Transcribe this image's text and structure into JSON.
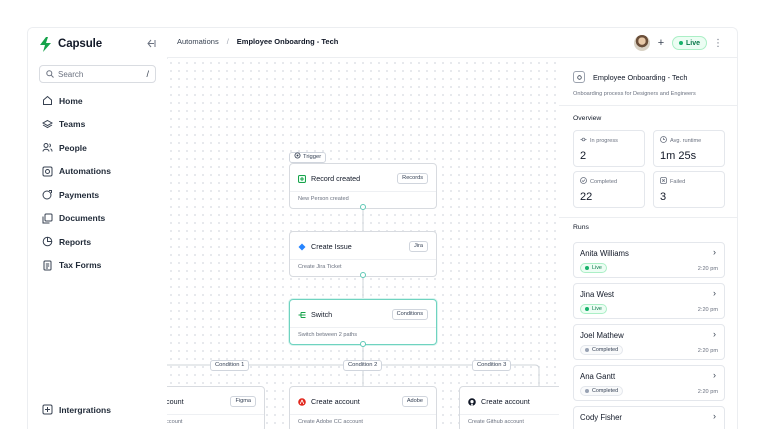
{
  "app": {
    "name": "Capsule"
  },
  "sidebar": {
    "search_placeholder": "Search",
    "search_shortcut": "/",
    "items": [
      {
        "label": "Home",
        "icon": "home-icon"
      },
      {
        "label": "Teams",
        "icon": "layers-icon"
      },
      {
        "label": "People",
        "icon": "users-icon"
      },
      {
        "label": "Automations",
        "icon": "automation-icon"
      },
      {
        "label": "Payments",
        "icon": "payments-icon"
      },
      {
        "label": "Documents",
        "icon": "documents-icon"
      },
      {
        "label": "Reports",
        "icon": "pie-chart-icon"
      },
      {
        "label": "Tax Forms",
        "icon": "file-text-icon"
      }
    ],
    "bottom_items": [
      {
        "label": "Intergrations",
        "icon": "integrations-icon"
      }
    ]
  },
  "header": {
    "breadcrumb": [
      "Automations",
      "/",
      "Employee Onboardng - Tech"
    ],
    "status": "Live"
  },
  "canvas": {
    "trigger_tag": "Trigger",
    "nodes": [
      {
        "title": "Record created",
        "badge": "Records",
        "desc": "New Person created"
      },
      {
        "title": "Create Issue",
        "badge": "Jira",
        "desc": "Create Jira Ticket"
      },
      {
        "title": "Switch",
        "badge": "Conditions",
        "desc": "Switch between 2 paths"
      },
      {
        "title": "count",
        "badge": "Figma",
        "desc": "ccount"
      },
      {
        "title": "Create account",
        "badge": "Adobe",
        "desc": "Create Adobe CC account"
      },
      {
        "title": "Create account",
        "badge": "",
        "desc": "Create Github account"
      }
    ],
    "conditions": [
      "Condition 1",
      "Condition 2",
      "Condition 3"
    ]
  },
  "panel": {
    "title": "Employee Onboarding - Tech",
    "subtitle": "Onboarding process for Designers and Engineers",
    "overview_label": "Overview",
    "stats": [
      {
        "label": "In progress",
        "value": "2"
      },
      {
        "label": "Avg. runtime",
        "value": "1m 25s"
      },
      {
        "label": "Completed",
        "value": "22"
      },
      {
        "label": "Failed",
        "value": "3"
      }
    ],
    "runs_label": "Runs",
    "runs": [
      {
        "name": "Anita Williams",
        "status": "Live",
        "time": "2:20 pm"
      },
      {
        "name": "Jina West",
        "status": "Live",
        "time": "2:20 pm"
      },
      {
        "name": "Joel Mathew",
        "status": "Completed",
        "time": "2:20 pm"
      },
      {
        "name": "Ana Gantt",
        "status": "Completed",
        "time": "2:20 pm"
      },
      {
        "name": "Cody Fisher",
        "status": "",
        "time": ""
      }
    ]
  },
  "colors": {
    "brand": "#16a34a",
    "accent": "#5ec8b5",
    "live": "#17b26a"
  }
}
